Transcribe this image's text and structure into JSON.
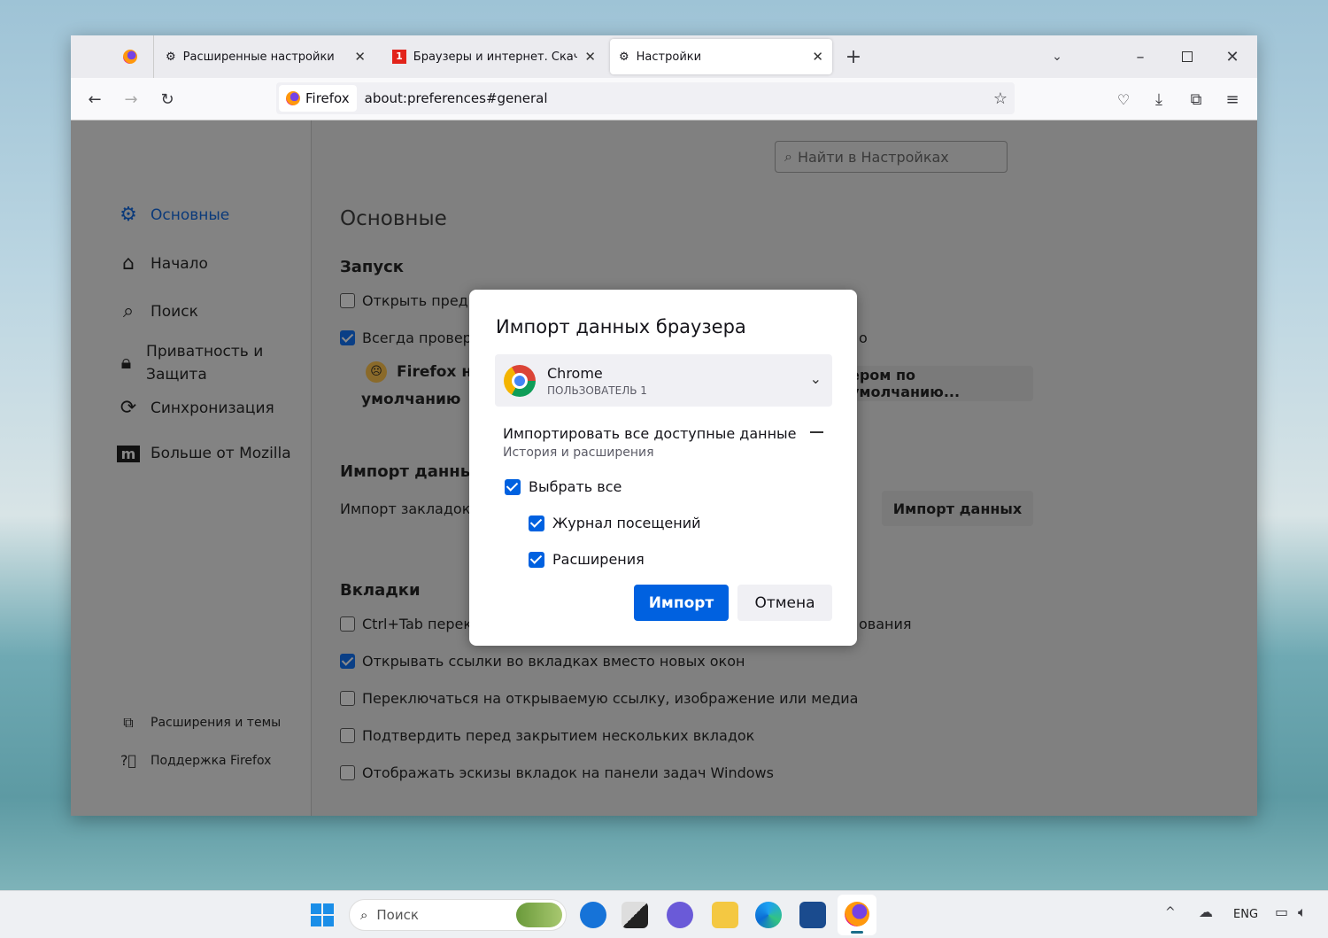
{
  "browser": {
    "tabs": [
      {
        "label": "Расширенные настройки",
        "icon": "gear-icon"
      },
      {
        "label": "Браузеры и интернет. Скачать",
        "icon": "site-favicon"
      },
      {
        "label": "Настройки",
        "icon": "gear-icon",
        "active": true
      }
    ],
    "identity_label": "Firefox",
    "url": "about:preferences#general"
  },
  "sidebar": {
    "items": [
      {
        "label": "Основные",
        "icon": "gear-icon",
        "active": true
      },
      {
        "label": "Начало",
        "icon": "home-icon"
      },
      {
        "label": "Поиск",
        "icon": "search-icon"
      },
      {
        "label": "Приватность и Защита",
        "icon": "lock-icon"
      },
      {
        "label": "Синхронизация",
        "icon": "sync-icon"
      },
      {
        "label": "Больше от Mozilla",
        "icon": "mozilla-icon"
      }
    ],
    "footer": [
      {
        "label": "Расширения и темы",
        "icon": "puzzle-icon"
      },
      {
        "label": "Поддержка Firefox",
        "icon": "help-icon"
      }
    ]
  },
  "prefs": {
    "search_placeholder": "Найти в Настройках",
    "page_title": "Основные",
    "startup_heading": "Запуск",
    "open_previous": "Открыть преды",
    "always_check": "Всегда проверя",
    "always_check_tail": "о",
    "not_default_1": "Firefox не",
    "not_default_2": "умолчанию",
    "make_default_button": "ером по умолчанию...",
    "import_heading": "Импорт данных",
    "import_text": "Импорт закладок,",
    "import_button": "Импорт данных",
    "tabs_heading": "Вкладки",
    "ctrl_tab": "Ctrl+Tab перекл",
    "ctrl_tab_tail": "ования",
    "tab_options": [
      {
        "label": "Открывать ссылки во вкладках вместо новых окон",
        "checked": true
      },
      {
        "label": "Переключаться на открываемую ссылку, изображение или медиа",
        "checked": false
      },
      {
        "label": "Подтвердить перед закрытием нескольких вкладок",
        "checked": false
      },
      {
        "label": "Отображать эскизы вкладок на панели задач Windows",
        "checked": false
      }
    ]
  },
  "dialog": {
    "title": "Импорт данных браузера",
    "browser_name": "Chrome",
    "profile": "ПОЛЬЗОВАТЕЛЬ 1",
    "summary_title": "Импортировать все доступные данные",
    "summary_sub": "История и расширения",
    "select_all": "Выбрать все",
    "options": [
      "Журнал посещений",
      "Расширения"
    ],
    "import_button": "Импорт",
    "cancel_button": "Отмена",
    "accent": "#0061e0"
  },
  "taskbar": {
    "search_placeholder": "Поиск",
    "lang": "ENG"
  }
}
